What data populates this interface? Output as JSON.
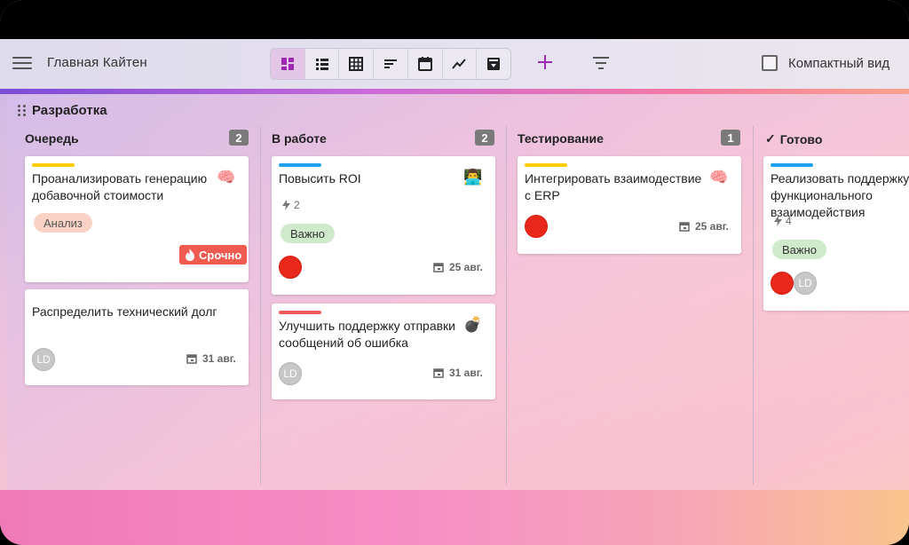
{
  "app": {
    "title": "Главная Кайтен"
  },
  "toolbar": {
    "views": [
      {
        "icon": "board-view-icon",
        "active": true
      },
      {
        "icon": "list-view-icon",
        "active": false
      },
      {
        "icon": "table-view-icon",
        "active": false
      },
      {
        "icon": "sort-icon",
        "active": false
      },
      {
        "icon": "calendar-icon",
        "active": false
      },
      {
        "icon": "chart-icon",
        "active": false
      },
      {
        "icon": "archive-icon",
        "active": false
      }
    ],
    "add_icon": "plus-icon",
    "filter_icon": "filter-icon",
    "compact_label": "Компактный вид",
    "compact_checked": false
  },
  "colors": {
    "accent": "#9c27b0",
    "urgent": "#f05a4f",
    "yellow": "#ffcc00",
    "blue": "#1ea0ef",
    "red": "#f05a5a"
  },
  "board": {
    "group_title": "Разработка",
    "columns": [
      {
        "title": "Очередь",
        "count": "2",
        "cards": [
          {
            "title": "Проанализировать генерацию добавочной стоимости",
            "stripe": "#ffcc00",
            "emoji": "🧠",
            "tag": "Анализ",
            "urgent": "Срочно"
          },
          {
            "title": "Распределить технический долг",
            "avatar": "LD",
            "date": "31 авг."
          }
        ]
      },
      {
        "title": "В работе",
        "count": "2",
        "cards": [
          {
            "title": "Повысить ROI",
            "stripe": "#1ea0ef",
            "emoji": "👨‍💻",
            "points": "2",
            "tag": "Важно",
            "date": "25 авг."
          },
          {
            "title": "Улучшить поддержку отправки сообщений об ошибка",
            "stripe": "#f05a5a",
            "emoji": "💣",
            "avatar": "LD",
            "date": "31 авг."
          }
        ]
      },
      {
        "title": "Тестирование",
        "count": "1",
        "cards": [
          {
            "title": "Интегрировать взаимодествие с ERP",
            "stripe": "#ffcc00",
            "emoji": "🧠",
            "date": "25 авг."
          }
        ]
      },
      {
        "title": "Готово",
        "check": "✓",
        "cards": [
          {
            "title": "Реализовать поддержку функционального взаимодействия",
            "stripe": "#1ea0ef",
            "points": "4",
            "tag": "Важно",
            "avatar": "LD"
          }
        ]
      }
    ]
  }
}
